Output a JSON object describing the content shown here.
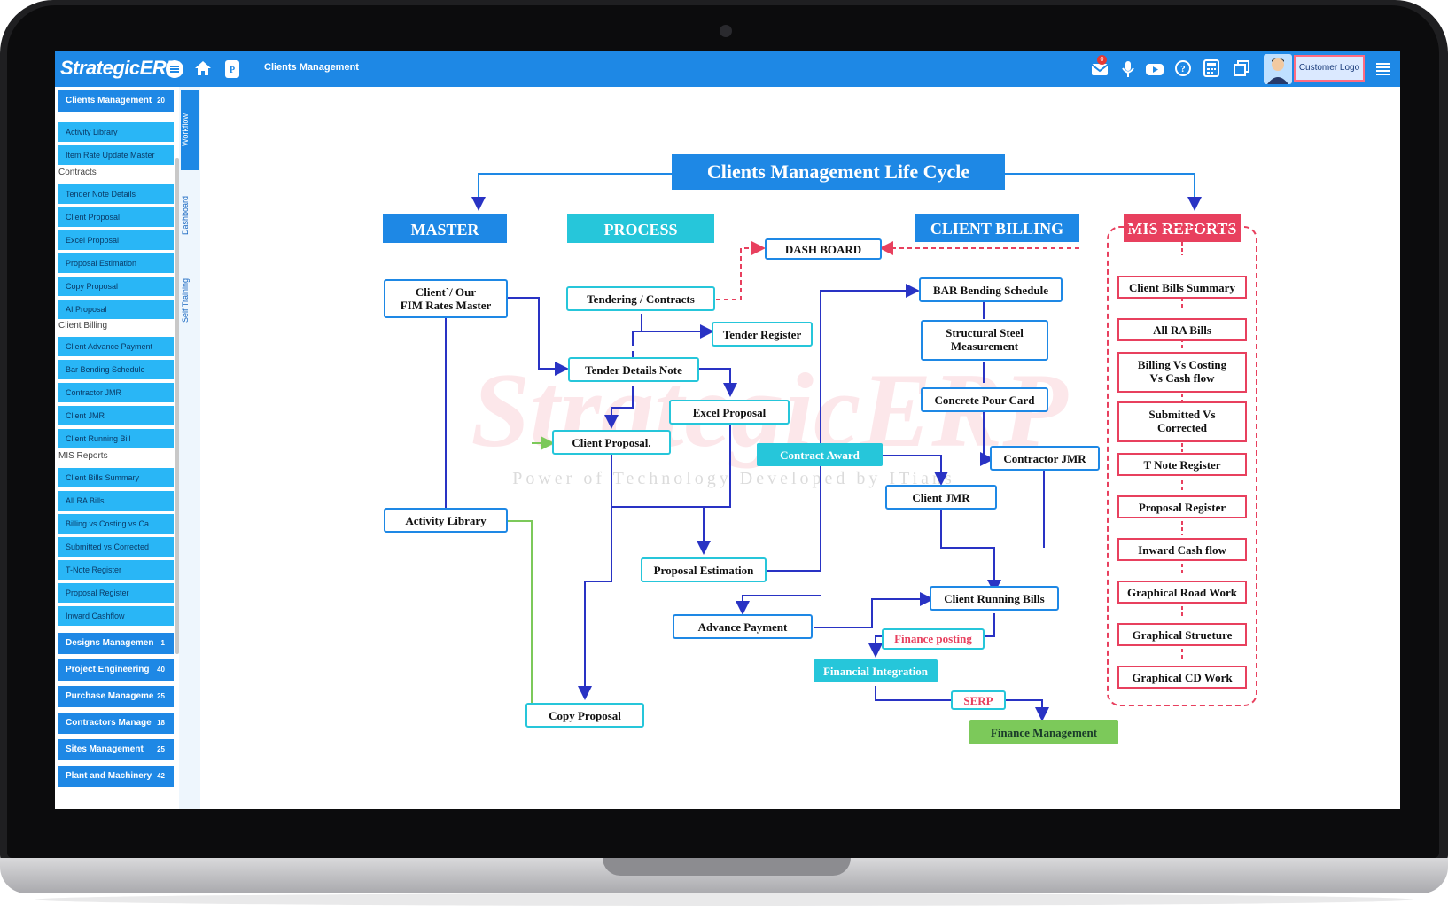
{
  "app": {
    "brand": "StrategicERP",
    "page_title": "Clients Management",
    "customer_logo": "Customer Logo",
    "notification_count": "0"
  },
  "topbar_icons": [
    "menu-icon",
    "home-icon",
    "p-badge-icon",
    "mail-icon",
    "mic-icon",
    "youtube-icon",
    "help-icon",
    "calculator-icon",
    "copy-icon",
    "user-avatar",
    "list-icon"
  ],
  "sidebar": {
    "header": {
      "label": "Clients Management",
      "count": "20"
    },
    "sections": [
      {
        "title": "",
        "items": [
          "Activity Library",
          "Item Rate Update Master"
        ]
      },
      {
        "title": "Contracts",
        "items": [
          "Tender Note Details",
          "Client Proposal",
          "Excel Proposal",
          "Proposal Estimation",
          "Copy Proposal",
          "AI Proposal"
        ]
      },
      {
        "title": "Client Billing",
        "items": [
          "Client Advance Payment",
          "Bar Bending Schedule",
          "Contractor JMR",
          "Client JMR",
          "Client Running Bill"
        ]
      },
      {
        "title": "MIS Reports",
        "items": [
          "Client Bills Summary",
          "All RA Bills",
          "Billing vs Costing vs Ca..",
          "Submitted vs Corrected",
          "T-Note Register",
          "Proposal Register",
          "Inward Cashflow"
        ]
      }
    ],
    "modules": [
      {
        "label": "Designs Managemen",
        "count": "1"
      },
      {
        "label": "Project Engineering",
        "count": "40"
      },
      {
        "label": "Purchase Manageme",
        "count": "25"
      },
      {
        "label": "Contractors Manage",
        "count": "18"
      },
      {
        "label": "Sites Management",
        "count": "25"
      },
      {
        "label": "Plant and Machinery",
        "count": "42"
      }
    ]
  },
  "vertical_tabs": [
    "Workflow",
    "Dashboard",
    "Self Training"
  ],
  "diagram": {
    "title": "Clients Management Life Cycle",
    "watermark": "StrategicERP",
    "watermark_sub": "Power of Technology Developed by ITians",
    "columns": {
      "master": "MASTER",
      "process": "PROCESS",
      "billing": "CLIENT BILLING",
      "mis": "MIS REPORTS"
    },
    "master_nodes": {
      "rates": [
        "Client`/ Our",
        "FIM Rates Master"
      ],
      "activity": "Activity Library"
    },
    "process_nodes": {
      "tendering": "Tendering / Contracts",
      "tender_register": "Tender Register",
      "tender_details": "Tender Details Note",
      "excel": "Excel Proposal",
      "client_proposal": "Client Proposal.",
      "proposal_est": "Proposal Estimation",
      "advance": "Advance Payment",
      "copy": "Copy Proposal"
    },
    "billing_nodes": {
      "dashboard": "DASH BOARD",
      "bar": "BAR Bending Schedule",
      "steel": [
        "Structural Steel",
        "Measurement"
      ],
      "concrete": "Concrete Pour Card",
      "contract_award": "Contract Award",
      "contractor_jmr": "Contractor JMR",
      "client_jmr": "Client JMR",
      "running_bills": "Client Running  Bills",
      "finance_posting": "Finance posting",
      "financial_integration": "Financial Integration",
      "serp": "SERP",
      "finance_mgmt": "Finance  Management"
    },
    "mis_nodes": [
      [
        "Client Bills Summary"
      ],
      [
        "All RA Bills"
      ],
      [
        "Billing Vs Costing",
        "Vs Cash flow"
      ],
      [
        "Submitted Vs",
        "Corrected"
      ],
      [
        "T Note Register"
      ],
      [
        "Proposal Register"
      ],
      [
        "Inward Cash flow"
      ],
      [
        "Graphical Road Work"
      ],
      [
        "Graphical Strueture"
      ],
      [
        "Graphical  CD Work"
      ]
    ],
    "colors": {
      "blue": "#1e88e5",
      "cyan": "#26c6da",
      "pink": "#e8405e",
      "green": "#7cc95a",
      "navy": "#1a237e",
      "line": "#2933c4"
    }
  }
}
